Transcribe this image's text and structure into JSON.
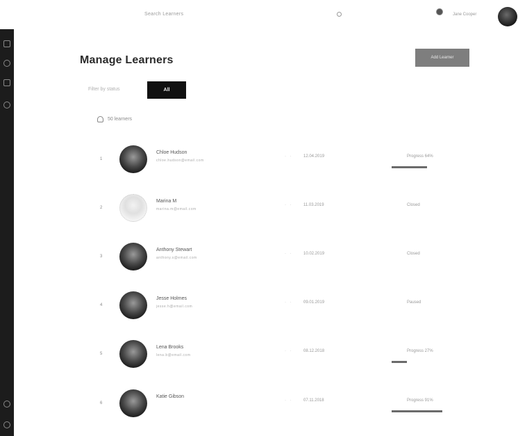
{
  "header": {
    "search_text": "Search Learners",
    "user_name": "Jane Cooper"
  },
  "sidebar": {
    "icons": [
      "grid-icon",
      "globe-icon",
      "users-icon",
      "settings-icon",
      "help-icon",
      "logout-icon"
    ]
  },
  "page": {
    "title": "Manage Learners",
    "corner_button_label": "Add Learner"
  },
  "filter": {
    "label": "Filter by status",
    "active_label": "All"
  },
  "count": {
    "text": "50 learners"
  },
  "learners": [
    {
      "num": "1",
      "name": "Chloe Hudson",
      "sub": "chloe.hudson@email.com",
      "date": "12.04.2019",
      "status": "Progress 64%",
      "progress": 0.64,
      "avatar": "dark"
    },
    {
      "num": "2",
      "name": "Marina M",
      "sub": "marina.m@email.com",
      "date": "11.03.2019",
      "status": "Closed",
      "progress": null,
      "avatar": "light"
    },
    {
      "num": "3",
      "name": "Anthony Stewart",
      "sub": "anthony.s@email.com",
      "date": "10.02.2019",
      "status": "Closed",
      "progress": null,
      "avatar": "dark"
    },
    {
      "num": "4",
      "name": "Jesse Holmes",
      "sub": "jesse.h@email.com",
      "date": "09.01.2019",
      "status": "Paused",
      "progress": null,
      "avatar": "dark"
    },
    {
      "num": "5",
      "name": "Lena Brooks",
      "sub": "lena.b@email.com",
      "date": "08.12.2018",
      "status": "Progress 27%",
      "progress": 0.27,
      "avatar": "dark"
    },
    {
      "num": "6",
      "name": "Katie Gibson",
      "sub": "",
      "date": "07.11.2018",
      "status": "Progress 91%",
      "progress": 0.91,
      "avatar": "dark"
    }
  ]
}
